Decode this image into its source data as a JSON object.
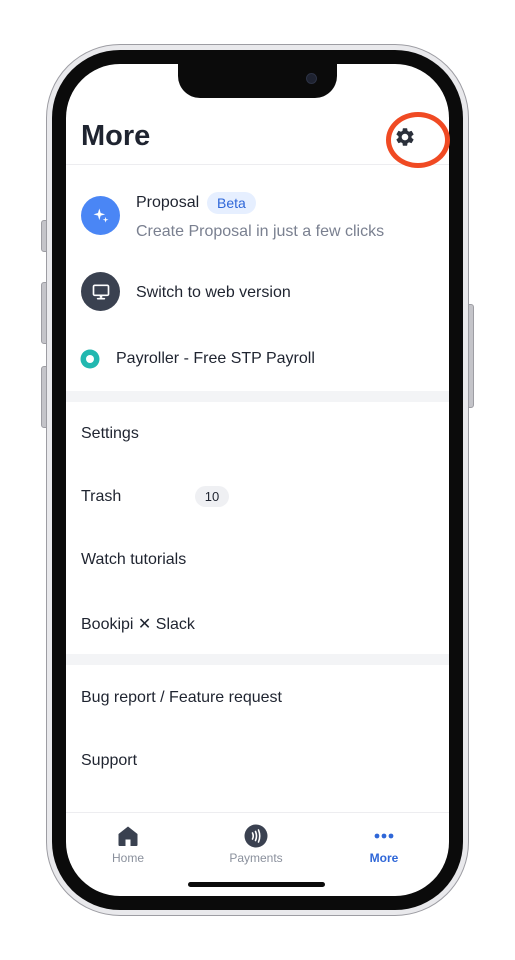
{
  "header": {
    "title": "More"
  },
  "features": {
    "proposal": {
      "title": "Proposal",
      "badge": "Beta",
      "subtitle": "Create Proposal in just a few clicks"
    },
    "web_version": {
      "title": "Switch to web version"
    },
    "payroller": {
      "title": "Payroller - Free STP Payroll"
    }
  },
  "menu": {
    "settings": "Settings",
    "trash": "Trash",
    "trash_count": "10",
    "tutorials": "Watch tutorials",
    "slack": "Bookipi ✕ Slack",
    "bug_report": "Bug report / Feature request",
    "support": "Support"
  },
  "tabs": [
    {
      "label": "Home",
      "icon": "home-icon",
      "active": false
    },
    {
      "label": "Payments",
      "icon": "payments-icon",
      "active": false
    },
    {
      "label": "More",
      "icon": "more-icon",
      "active": true
    }
  ],
  "colors": {
    "accent": "#2f67d8",
    "highlight": "#f04a23",
    "proposal_icon": "#4a86f5",
    "web_icon": "#3a4150",
    "payroller": "#22b8b0"
  }
}
